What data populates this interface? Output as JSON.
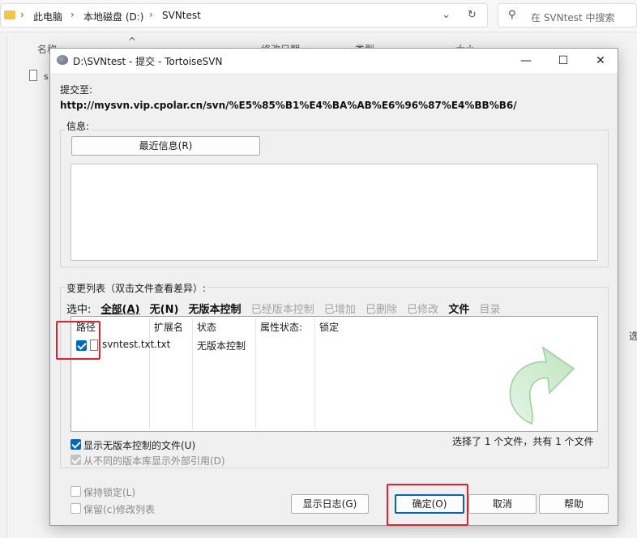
{
  "explorer": {
    "breadcrumb": [
      "此电脑",
      "本地磁盘 (D:)",
      "SVNtest"
    ],
    "search_placeholder": "在 SVNtest 中搜索",
    "columns": [
      "名称",
      "修改日期",
      "类型",
      "大小"
    ],
    "side_file_label": "s",
    "right_edge_text": "选"
  },
  "dialog": {
    "title": "D:\\SVNtest - 提交 - TortoiseSVN",
    "commit_to_label": "提交至:",
    "commit_url": "http://mysvn.vip.cpolar.cn/svn/%E5%85%B1%E4%BA%AB%E6%96%87%E4%BB%B6/",
    "message_label": "信息:",
    "recent_messages_button": "最近信息(R)",
    "changes_label": "变更列表（双击文件查看差异）:",
    "select_label": "选中:",
    "filters": [
      {
        "label": "全部(A)",
        "active": true
      },
      {
        "label": "无(N)",
        "active": true
      },
      {
        "label": "无版本控制",
        "active": true
      },
      {
        "label": "已经版本控制",
        "active": false
      },
      {
        "label": "已增加",
        "active": false
      },
      {
        "label": "已删除",
        "active": false
      },
      {
        "label": "已修改",
        "active": false
      },
      {
        "label": "文件",
        "active": true
      },
      {
        "label": "目录",
        "active": false
      }
    ],
    "list_columns": [
      "路径",
      "扩展名",
      "状态",
      "属性状态:",
      "锁定"
    ],
    "files": [
      {
        "path": "svntest.txt",
        "ext": ".txt",
        "status": "无版本控制",
        "checked": true
      }
    ],
    "show_unversioned": "显示无版本控制的文件(U)",
    "show_externals": "从不同的版本库显示外部引用(D)",
    "selection_summary": "选择了 1 个文件，共有 1 个文件",
    "keep_locks": "保持锁定(L)",
    "keep_changelists": "保留(c)修改列表",
    "buttons": {
      "show_log": "显示日志(G)",
      "ok": "确定(O)",
      "cancel": "取消",
      "help": "帮助"
    }
  }
}
